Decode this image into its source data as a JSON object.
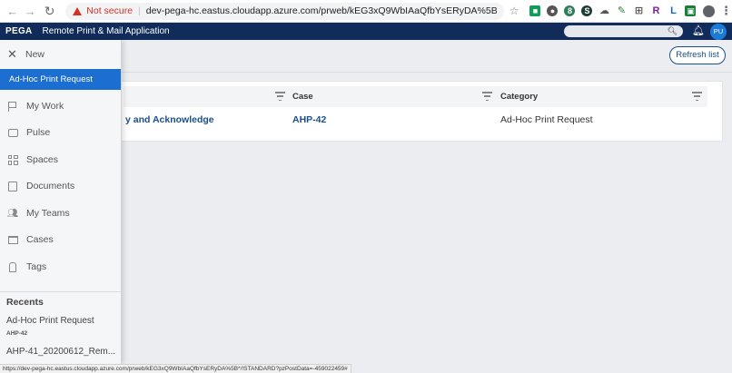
{
  "browser": {
    "not_secure": "Not secure",
    "url": "dev-pega-hc.eastus.cloudapp.azure.com/prweb/kEG3xQ9WbIAaQfbYsERyDA%5B*/!STANDARD?pzPostData=-4...",
    "status_url": "https://dev-pega-hc.eastus.cloudapp.azure.com/prweb/kEG3xQ9WbIAaQfbYsERyDA%5B*/!STANDARD?pzPostData=-459022459#",
    "extensions": [
      {
        "label": "■",
        "color": "#0f9d58"
      },
      {
        "label": "●",
        "color": "#555555"
      },
      {
        "label": "8",
        "color": "#2e7d5b"
      },
      {
        "label": "S",
        "color": "#1d3c34"
      },
      {
        "label": "☁",
        "color": "#888888"
      },
      {
        "label": "✎",
        "color": "#2e7d32"
      },
      {
        "label": "⊞",
        "color": "#666666"
      },
      {
        "label": "R",
        "color": "#7b1fa2"
      },
      {
        "label": "L",
        "color": "#1565c0"
      },
      {
        "label": "▣",
        "color": "#1b7f3b"
      }
    ]
  },
  "header": {
    "logo": "PEGA",
    "app_title": "Remote Print & Mail Application",
    "avatar_initials": "PU"
  },
  "toolbar": {
    "refresh_label": "Refresh list"
  },
  "table": {
    "columns": [
      "",
      "Case",
      "Category"
    ],
    "rows": [
      {
        "task": "y and Acknowledge",
        "case": "AHP-42",
        "category": "Ad-Hoc Print Request"
      }
    ]
  },
  "sidenav": {
    "new_label": "New",
    "active_label": "Ad-Hoc Print Request",
    "items": [
      {
        "label": "My Work",
        "icon": "flag-icon"
      },
      {
        "label": "Pulse",
        "icon": "chat-icon"
      },
      {
        "label": "Spaces",
        "icon": "grid-icon"
      },
      {
        "label": "Documents",
        "icon": "document-icon"
      },
      {
        "label": "My Teams",
        "icon": "people-icon"
      },
      {
        "label": "Cases",
        "icon": "tray-icon"
      },
      {
        "label": "Tags",
        "icon": "tag-icon"
      }
    ],
    "recents_title": "Recents",
    "recents": [
      {
        "label": "Ad-Hoc Print Request",
        "sub": "AHP-42"
      },
      {
        "label": "AHP-41_20200612_Rem...",
        "sub": ""
      }
    ]
  },
  "colors": {
    "header_bg": "#112c5a",
    "active_nav": "#1c6ed0",
    "link": "#1a4f8b",
    "avatar": "#1c7ad9"
  }
}
